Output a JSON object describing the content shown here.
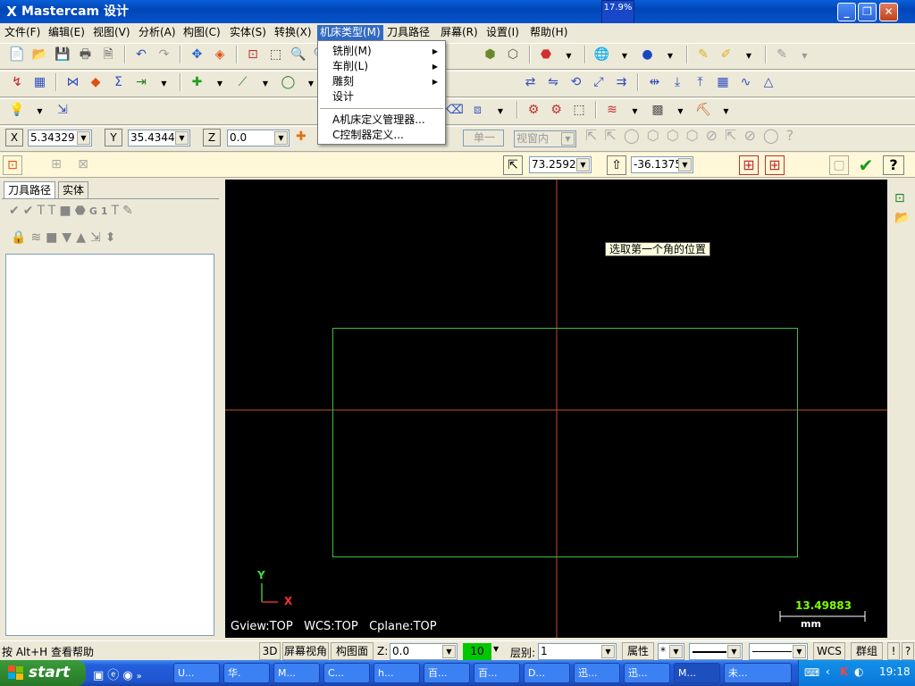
{
  "window": {
    "title": "Mastercam 设计",
    "progress_badge": "17.9%"
  },
  "menubar": {
    "items": [
      "文件(F)",
      "编辑(E)",
      "视图(V)",
      "分析(A)",
      "构图(C)",
      "实体(S)",
      "转换(X)",
      "机床类型(M)",
      "刀具路径",
      "屏幕(R)",
      "设置(I)",
      "帮助(H)"
    ]
  },
  "machine_menu": {
    "items": [
      {
        "label": "铣削(M)",
        "has_submenu": true
      },
      {
        "label": "车削(L)",
        "has_submenu": true
      },
      {
        "label": "雕刻",
        "has_submenu": true
      },
      {
        "label": "设计",
        "has_submenu": false
      },
      {
        "label": "A机床定义管理器...",
        "has_submenu": false
      },
      {
        "label": "C控制器定义...",
        "has_submenu": false
      }
    ]
  },
  "coords": {
    "x_label": "X",
    "x_value": "5.34329",
    "y_label": "Y",
    "y_value": "35.43444",
    "z_label": "Z",
    "z_value": "0.0",
    "single_btn": "单一",
    "window_mode": "视窗内"
  },
  "ribbon": {
    "width_value": "73.25929",
    "height_value": "-36.1375"
  },
  "left_panel": {
    "tabs": [
      "刀具路径",
      "实体"
    ],
    "g1_label": "G1"
  },
  "viewport": {
    "prompt": "选取第一个角的位置",
    "gview": "Gview:TOP",
    "wcs": "WCS:TOP",
    "cplane": "Cplane:TOP",
    "axis_y": "Y",
    "axis_x": "X",
    "scale_value": "13.49883",
    "scale_unit": "mm",
    "colors": {
      "background": "#000000",
      "crosshair": "#c0502a",
      "rectangle": "#3fbf3f"
    }
  },
  "statusbar": {
    "help_text": "按 Alt+H 查看帮助",
    "btn_3d": "3D",
    "btn_screen_view": "屏幕视角",
    "btn_cplane": "构图面",
    "z_label": "Z:",
    "z_value": "0.0",
    "color_value": "10",
    "level_label": "层别:",
    "level_value": "1",
    "attributes": "属性",
    "point_style": "*",
    "wcs": "WCS",
    "group": "群组",
    "extra": "!",
    "help": "?"
  },
  "taskbar": {
    "start": "start",
    "tasks": [
      "U...",
      "华.",
      "M...",
      "C...",
      "h...",
      "百...",
      "百...",
      "D...",
      "迅...",
      "迅...",
      "M...",
      "未..."
    ],
    "active_index": 10,
    "clock": "19:18"
  }
}
